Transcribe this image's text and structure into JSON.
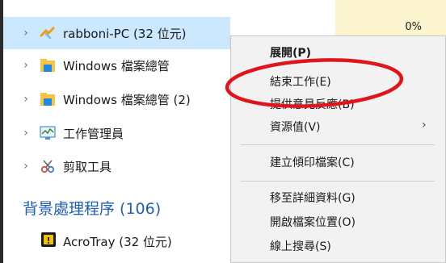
{
  "process_list": {
    "rows": [
      {
        "label": "rabboni-PC (32 位元)",
        "usage": "0%"
      },
      {
        "label": "Windows 檔案總管"
      },
      {
        "label": "Windows 檔案總管 (2)"
      },
      {
        "label": "工作管理員"
      },
      {
        "label": "剪取工具"
      }
    ],
    "section_title": "背景處理程序 (106)",
    "background_rows": [
      {
        "label": "AcroTray (32 位元)"
      }
    ]
  },
  "context_menu": {
    "items": [
      {
        "label": "展開(P)",
        "bold": true
      },
      {
        "label": "結束工作(E)"
      },
      {
        "label": "提供意見反應(B)"
      },
      {
        "label": "資源值(V)",
        "has_submenu": true
      },
      {
        "label": "建立傾印檔案(C)"
      },
      {
        "label": "移至詳細資料(G)"
      },
      {
        "label": "開啟檔案位置(O)"
      },
      {
        "label": "線上搜尋(S)"
      }
    ]
  },
  "colors": {
    "selected_row": "#cce8ff",
    "usage_column": "#fdf5d0",
    "section_title": "#1f5fb4",
    "annotation_ellipse": "#e0141b"
  },
  "icons": {
    "chevron": "›",
    "submenu_arrow": "›"
  }
}
